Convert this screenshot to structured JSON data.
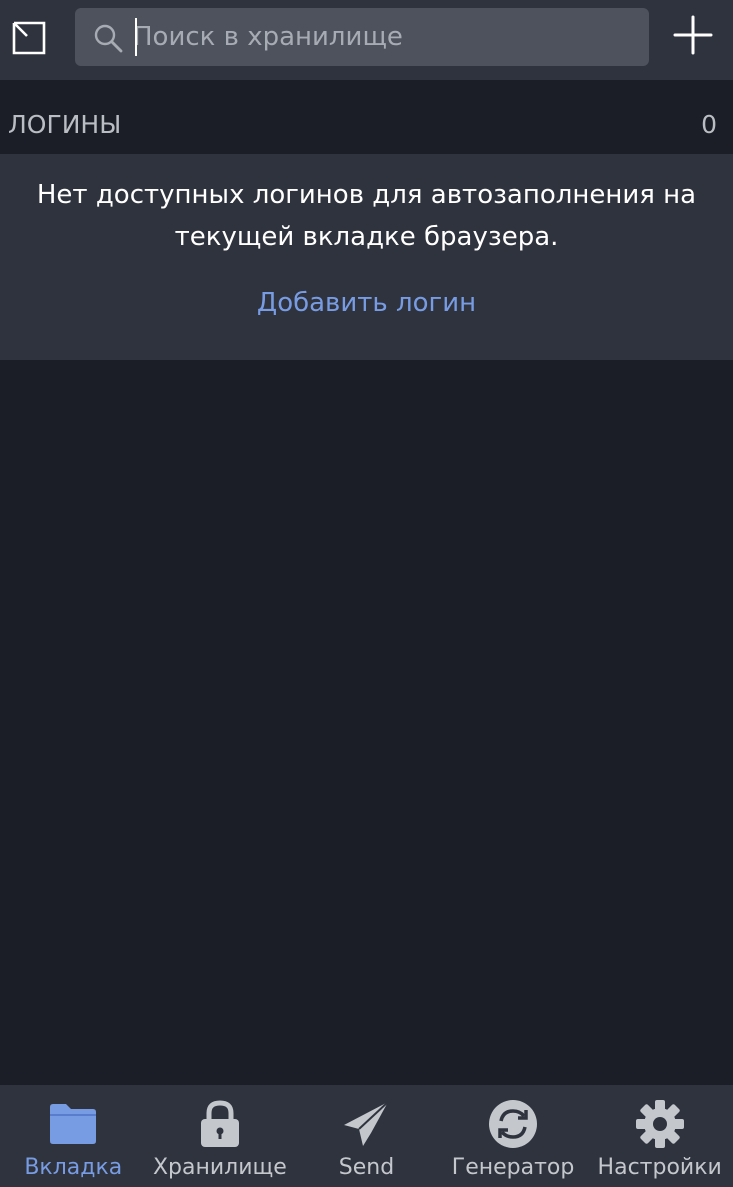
{
  "header": {
    "search_placeholder": "Поиск в хранилище"
  },
  "section": {
    "title": "ЛОГИНЫ",
    "count": "0"
  },
  "empty_state": {
    "message_line1": "Нет доступных логинов для автозаполнения на",
    "message_line2": "текущей вкладке браузера.",
    "add_login_label": "Добавить логин"
  },
  "tabs": [
    {
      "label": "Вкладка",
      "icon": "folder-icon",
      "active": true
    },
    {
      "label": "Хранилище",
      "icon": "lock-icon",
      "active": false
    },
    {
      "label": "Send",
      "icon": "send-icon",
      "active": false
    },
    {
      "label": "Генератор",
      "icon": "refresh-icon",
      "active": false
    },
    {
      "label": "Настройки",
      "icon": "gear-icon",
      "active": false
    }
  ],
  "colors": {
    "background": "#1b1e26",
    "surface": "#2f333d",
    "search_field": "#4d525d",
    "accent": "#789ce4",
    "muted_text": "#babdc3"
  }
}
